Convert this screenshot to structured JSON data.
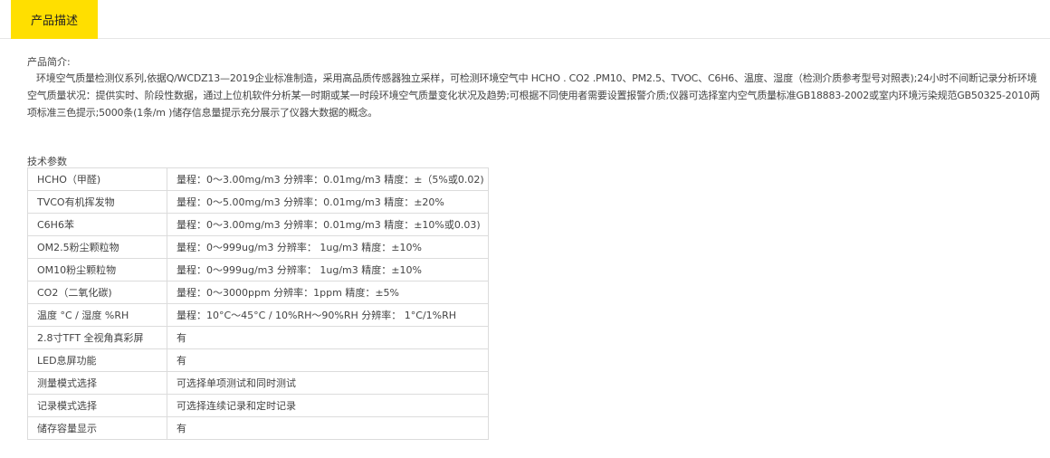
{
  "tabs": [
    {
      "label": "产品描述"
    }
  ],
  "intro": {
    "heading": "产品简介:",
    "text": "环境空气质量检测仪系列,依据Q/WCDZ13—2019企业标准制造，采用高品质传感器独立采样，可检测环境空气中 HCHO . CO2 .PM10、PM2.5、TVOC、C6H6、温度、湿度（检测介质参考型号对照表);24小时不间断记录分析环境空气质量状况：提供实时、阶段性数据，通过上位机软件分析某一时期或某一时段环境空气质量变化状况及趋势;可根据不同使用者需要设置报警介质;仪器可选择室内空气质量标准GB18883-2002或室内环境污染规范GB50325-2010两项标准三色提示;5000条(1条/m )储存信息量提示充分展示了仪器大数据的概念。"
  },
  "specs": {
    "heading": "技术参数",
    "rows": [
      {
        "name": "HCHO（甲醛)",
        "value": "量程：0～3.00mg/m3    分辨率：0.01mg/m3     精度：±（5%或0.02)"
      },
      {
        "name": "TVCO有机挥发物",
        "value": "量程：0～5.00mg/m3    分辨率：0.01mg/m3     精度：±20%"
      },
      {
        "name": "C6H6苯",
        "value": "量程：0～3.00mg/m3    分辨率：0.01mg/m3     精度：±10%或0.03)"
      },
      {
        "name": "OM2.5粉尘颗粒物",
        "value": "量程：0～999ug/m3   分辨率：  1ug/m3     精度：±10%"
      },
      {
        "name": "OM10粉尘颗粒物",
        "value": "量程：0～999ug/m3   分辨率：  1ug/m3     精度：±10%"
      },
      {
        "name": "CO2（二氧化碳)",
        "value": "量程：0～3000ppm   分辨率：1ppm     精度：±5%"
      },
      {
        "name": "温度 °C / 湿度 %RH",
        "value": "量程：10°C～45°C / 10%RH～90%RH  分辨率：  1°C/1%RH"
      },
      {
        "name": "2.8寸TFT 全视角真彩屏",
        "value": "有"
      },
      {
        "name": "LED息屏功能",
        "value": "有"
      },
      {
        "name": "测量模式选择",
        "value": "可选择单项测试和同时测试"
      },
      {
        "name": "记录模式选择",
        "value": "可选择连续记录和定时记录"
      },
      {
        "name": "储存容量显示",
        "value": "有"
      }
    ]
  },
  "colors": {
    "tab_active": "#ffdf00",
    "border": "#dcdcdc",
    "text": "#444444"
  }
}
